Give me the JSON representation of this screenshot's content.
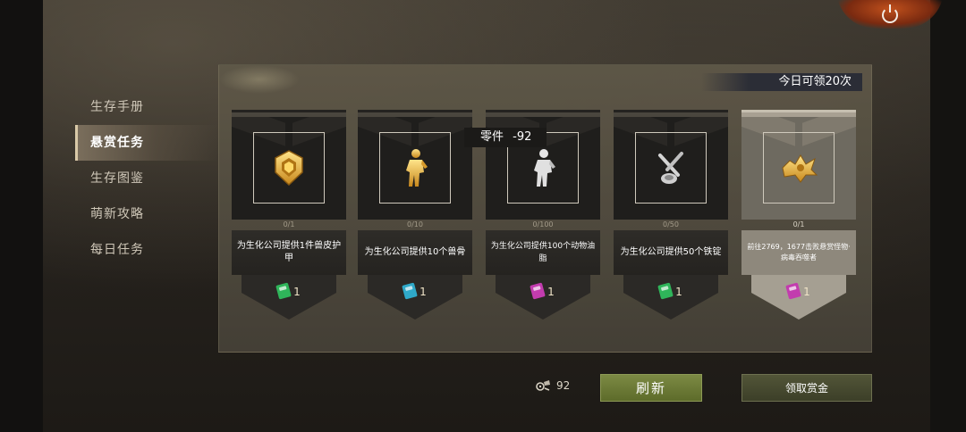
{
  "sidebar": {
    "items": [
      {
        "label": "生存手册",
        "active": false
      },
      {
        "label": "悬赏任务",
        "active": true
      },
      {
        "label": "生存图鉴",
        "active": false
      },
      {
        "label": "萌新攻略",
        "active": false
      },
      {
        "label": "每日任务",
        "active": false
      }
    ]
  },
  "panel": {
    "daily_limit": "今日可领20次"
  },
  "tooltip": {
    "label": "零件",
    "value": "-92"
  },
  "tasks": [
    {
      "icon": "armor-icon",
      "progress": "0/1",
      "description": "为生化公司提供1件兽皮护甲",
      "reward": "1",
      "reward_color": "#2fb55a"
    },
    {
      "icon": "figure-icon",
      "progress": "0/10",
      "description": "为生化公司提供10个兽骨",
      "reward": "1",
      "reward_color": "#2fa9c9"
    },
    {
      "icon": "figure-icon",
      "progress": "0/100",
      "description": "为生化公司提供100个动物油脂",
      "reward": "1",
      "reward_color": "#c23cae"
    },
    {
      "icon": "tools-icon",
      "progress": "0/50",
      "description": "为生化公司提供50个铁锭",
      "reward": "1",
      "reward_color": "#2fb55a"
    },
    {
      "icon": "badge-icon",
      "progress": "0/1",
      "description": "前往2769，1677击败悬赏怪物·病毒吞噬者",
      "reward": "1",
      "reward_color": "#c23cae"
    }
  ],
  "footer": {
    "parts_count": "92",
    "refresh_label": "刷新",
    "claim_label": "领取赏金"
  }
}
